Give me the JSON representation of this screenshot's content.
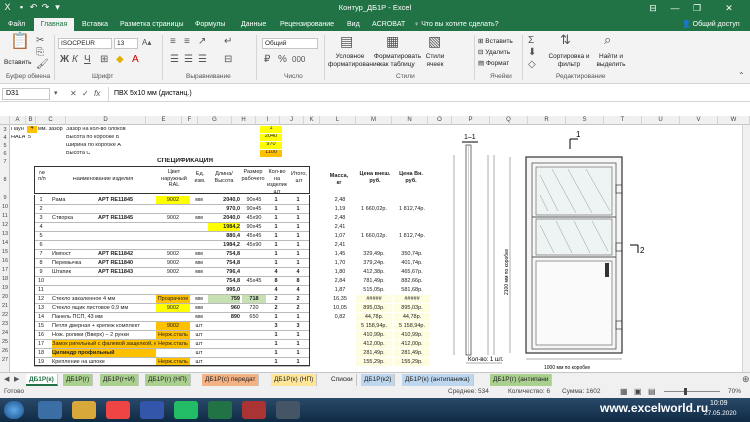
{
  "window": {
    "title": "Контур_ДБ1Р - Excel",
    "controls": {
      "help": "?",
      "ribbon_display": "⊟",
      "minimize": "—",
      "restore": "❐",
      "close": "✕"
    }
  },
  "tabs": [
    "Файл",
    "Главная",
    "Вставка",
    "Разметка страницы",
    "Формулы",
    "Данные",
    "Рецензирование",
    "Вид",
    "ACROBAT",
    "Что вы хотите сделать?",
    "Общий доступ"
  ],
  "ribbon": {
    "paste": "Вставить",
    "clipboard": "Буфер обмена",
    "font_name": "ISOCPEUR",
    "font_size": "13",
    "font_group": "Шрифт",
    "align_group": "Выравнивание",
    "number_format": "Общий",
    "number_group": "Число",
    "cond_format": "Условное форматирование",
    "format_table": "Форматировать как таблицу",
    "cell_styles": "Стили ячеек",
    "styles_group": "Стили",
    "insert": "Вставить",
    "delete": "Удалить",
    "format": "Формат",
    "cells_group": "Ячейки",
    "sort_filter": "Сортировка и фильтр",
    "find_select": "Найти и выделить",
    "edit_group": "Редактирование"
  },
  "formula_bar": {
    "name_box": "D31",
    "content": "ПВХ 5х10 мм (дистанц.)"
  },
  "columns": [
    "A",
    "B",
    "C",
    "D",
    "E",
    "F",
    "G",
    "H",
    "I",
    "J",
    "K",
    "L",
    "M",
    "N",
    "O",
    "P",
    "Q",
    "R",
    "S",
    "T",
    "U",
    "V",
    "W"
  ],
  "row_numbers": [
    "3",
    "4",
    "5",
    "6",
    "7",
    "8",
    "9",
    "10",
    "11",
    "12",
    "13",
    "14",
    "15",
    "16",
    "17",
    "18",
    "19",
    "20",
    "21",
    "22",
    "23",
    "24",
    "25",
    "26",
    "27"
  ],
  "top_block": {
    "a3": "Паун",
    "b3": "4",
    "c3": "мм. зазор",
    "d3": "Зазор на кол-во блоков",
    "j3": "1",
    "a4": "HALA",
    "b4": "5",
    "d4": "Высота по коробке Б",
    "j4": "2040",
    "d5": "Ширина по коробке А",
    "j5": "970",
    "d6": "Высота С",
    "j6": "1100"
  },
  "spec": {
    "title": "СПЕЦИФИКАЦИЯ",
    "headers": {
      "num": "№ п/п",
      "name": "Наименование изделия",
      "color": "Цвет наружный RAL",
      "unit": "Ед. изм.",
      "length": "Длина/ Высота",
      "size": "Размер рабочего",
      "count": "Кол-во на изделие шт",
      "total": "Итого, шт",
      "mass": "Масса, кг",
      "p1": "Цена внеш. руб.",
      "p2": "Цена Вн. руб."
    },
    "rows": [
      {
        "n": "1",
        "name": "Рама",
        "art": "АРТ RE11845",
        "color": "9002",
        "unit": "мм",
        "len": "2040,0",
        "size": "90х45",
        "q": "1",
        "t": "1",
        "m": "2,48",
        "p1": "",
        "p2": ""
      },
      {
        "n": "2",
        "name": "",
        "art": "",
        "color": "",
        "unit": "",
        "len": "970,0",
        "size": "90х45",
        "q": "1",
        "t": "1",
        "m": "1,19",
        "p1": "1 660,02р.",
        "p2": "1 812,74р."
      },
      {
        "n": "3",
        "name": "Створка",
        "art": "АРТ RE11845",
        "color": "9002",
        "unit": "мм",
        "len": "2040,0",
        "size": "45х90",
        "q": "1",
        "t": "1",
        "m": "2,48",
        "p1": "",
        "p2": ""
      },
      {
        "n": "4",
        "name": "",
        "art": "",
        "color": "",
        "unit": "",
        "len": "1984,2",
        "size": "90х45",
        "q": "1",
        "t": "1",
        "m": "2,41",
        "p1": "",
        "p2": ""
      },
      {
        "n": "5",
        "name": "",
        "art": "",
        "color": "",
        "unit": "",
        "len": "880,4",
        "size": "45х45",
        "q": "1",
        "t": "1",
        "m": "1,07",
        "p1": "1 660,02р.",
        "p2": "1 812,74р."
      },
      {
        "n": "6",
        "name": "",
        "art": "",
        "color": "",
        "unit": "",
        "len": "1984,2",
        "size": "45х90",
        "q": "1",
        "t": "1",
        "m": "2,41",
        "p1": "",
        "p2": ""
      },
      {
        "n": "7",
        "name": "Импост",
        "art": "АРТ RE11842",
        "color": "9002",
        "unit": "мм",
        "len": "754,8",
        "size": "",
        "q": "1",
        "t": "1",
        "m": "1,45",
        "p1": "329,49р.",
        "p2": "350,74р."
      },
      {
        "n": "8",
        "name": "Перемычка",
        "art": "АРТ RE11840",
        "color": "9002",
        "unit": "мм",
        "len": "754,8",
        "size": "",
        "q": "1",
        "t": "1",
        "m": "1,70",
        "p1": "379,24р.",
        "p2": "401,74р."
      },
      {
        "n": "9",
        "name": "Штапик",
        "art": "АРТ RE11843",
        "color": "9002",
        "unit": "мм",
        "len": "796,4",
        "size": "",
        "q": "4",
        "t": "4",
        "m": "1,80",
        "p1": "412,38р.",
        "p2": "465,67р."
      },
      {
        "n": "10",
        "name": "",
        "art": "",
        "color": "",
        "unit": "",
        "len": "754,8",
        "size": "45х45",
        "q": "8",
        "t": "8",
        "m": "2,84",
        "p1": "781,49р.",
        "p2": "882,66р."
      },
      {
        "n": "11",
        "name": "",
        "art": "",
        "color": "",
        "unit": "",
        "len": "995,0",
        "size": "",
        "q": "4",
        "t": "4",
        "m": "1,87",
        "p1": "515,05р.",
        "p2": "581,68р."
      },
      {
        "n": "12",
        "name": "Стекло закаленное 4 мм",
        "art": "",
        "color": "Прозрачное",
        "unit": "мм",
        "len": "759",
        "size": "718",
        "q": "2",
        "t": "2",
        "m": "16,35",
        "p1": "#####",
        "p2": "#####"
      },
      {
        "n": "13",
        "name": "Стекло ящик листовое 0,9 мм",
        "art": "",
        "color": "9002",
        "unit": "мм",
        "len": "960",
        "size": "720",
        "q": "2",
        "t": "2",
        "m": "10,05",
        "p1": "895,03р.",
        "p2": "895,03р."
      },
      {
        "n": "14",
        "name": "Панель ПСП, 43 мм",
        "art": "",
        "color": "",
        "unit": "мм",
        "len": "890",
        "size": "650",
        "q": "1",
        "t": "1",
        "m": "0,82",
        "p1": "44,78р.",
        "p2": "44,78р."
      },
      {
        "n": "15",
        "name": "Петля дверная + крепеж комплект",
        "art": "",
        "color": "9002",
        "unit": "шт",
        "len": "",
        "size": "",
        "q": "3",
        "t": "3",
        "m": "",
        "p1": "5 158,94р.",
        "p2": "5 158,94р."
      },
      {
        "n": "16",
        "name": "Нож. ролики (Вверх) – 2 рунки",
        "art": "",
        "color": "Нерж.сталь",
        "unit": "шт",
        "len": "",
        "size": "",
        "q": "1",
        "t": "1",
        "m": "",
        "p1": "410,99р.",
        "p2": "410,99р."
      },
      {
        "n": "17",
        "name": "Замок ригельный с фалевой защелкой, меди ручка",
        "art": "",
        "color": "Нерж.сталь",
        "unit": "шт",
        "len": "",
        "size": "",
        "q": "1",
        "t": "1",
        "m": "",
        "p1": "412,00р.",
        "p2": "412,00р."
      },
      {
        "n": "18",
        "name": "Цилиндр профильный",
        "art": "",
        "color": "",
        "unit": "шт",
        "len": "",
        "size": "",
        "q": "1",
        "t": "1",
        "m": "",
        "p1": "281,49р.",
        "p2": "281,49р."
      },
      {
        "n": "19",
        "name": "Крепление на шпоке",
        "art": "",
        "color": "Нерж.сталь",
        "unit": "шт",
        "len": "",
        "size": "",
        "q": "1",
        "t": "1",
        "m": "",
        "p1": "155,29р.",
        "p2": "155,29р."
      }
    ]
  },
  "drawing": {
    "section": "1–1",
    "mark1": "1",
    "mark2": "2",
    "dim_width": "1000 мм по коробке",
    "dim_height": "2100 мм по коробке",
    "door_count_label": "Кол-во: 1 шт."
  },
  "sheet_tabs": [
    {
      "label": "ДБ1Р(к)",
      "color": "#d9ead3",
      "active": true
    },
    {
      "label": "ДБ1Р(г)",
      "color": "#a9d08e"
    },
    {
      "label": "ДБ1Р(г+И)",
      "color": "#a9d08e"
    },
    {
      "label": "ДБ1Р(г) (НП)",
      "color": "#a9d08e"
    },
    {
      "label": "ДБ1Р(с) передат",
      "color": "#f4b183"
    },
    {
      "label": "ДБ1Р(к) (НП)",
      "color": "#ffe699"
    },
    {
      "label": "Списки",
      "color": "#f0f0f0"
    },
    {
      "label": "ДБ1Р(к2)",
      "color": "#bdd7ee"
    },
    {
      "label": "ДБ1Р(к) (антипаника)",
      "color": "#bdd7ee"
    },
    {
      "label": "ДБ1Р(г) (антипани",
      "color": "#a9d08e"
    }
  ],
  "status": {
    "ready": "Готово",
    "avg": "Среднее: 534",
    "count": "Количество: 6",
    "sum": "Сумма: 1602",
    "zoom": "70%"
  },
  "taskbar": {
    "time": "10:09",
    "date": "27.05.2020",
    "watermark": "www.excelworld.ru"
  }
}
